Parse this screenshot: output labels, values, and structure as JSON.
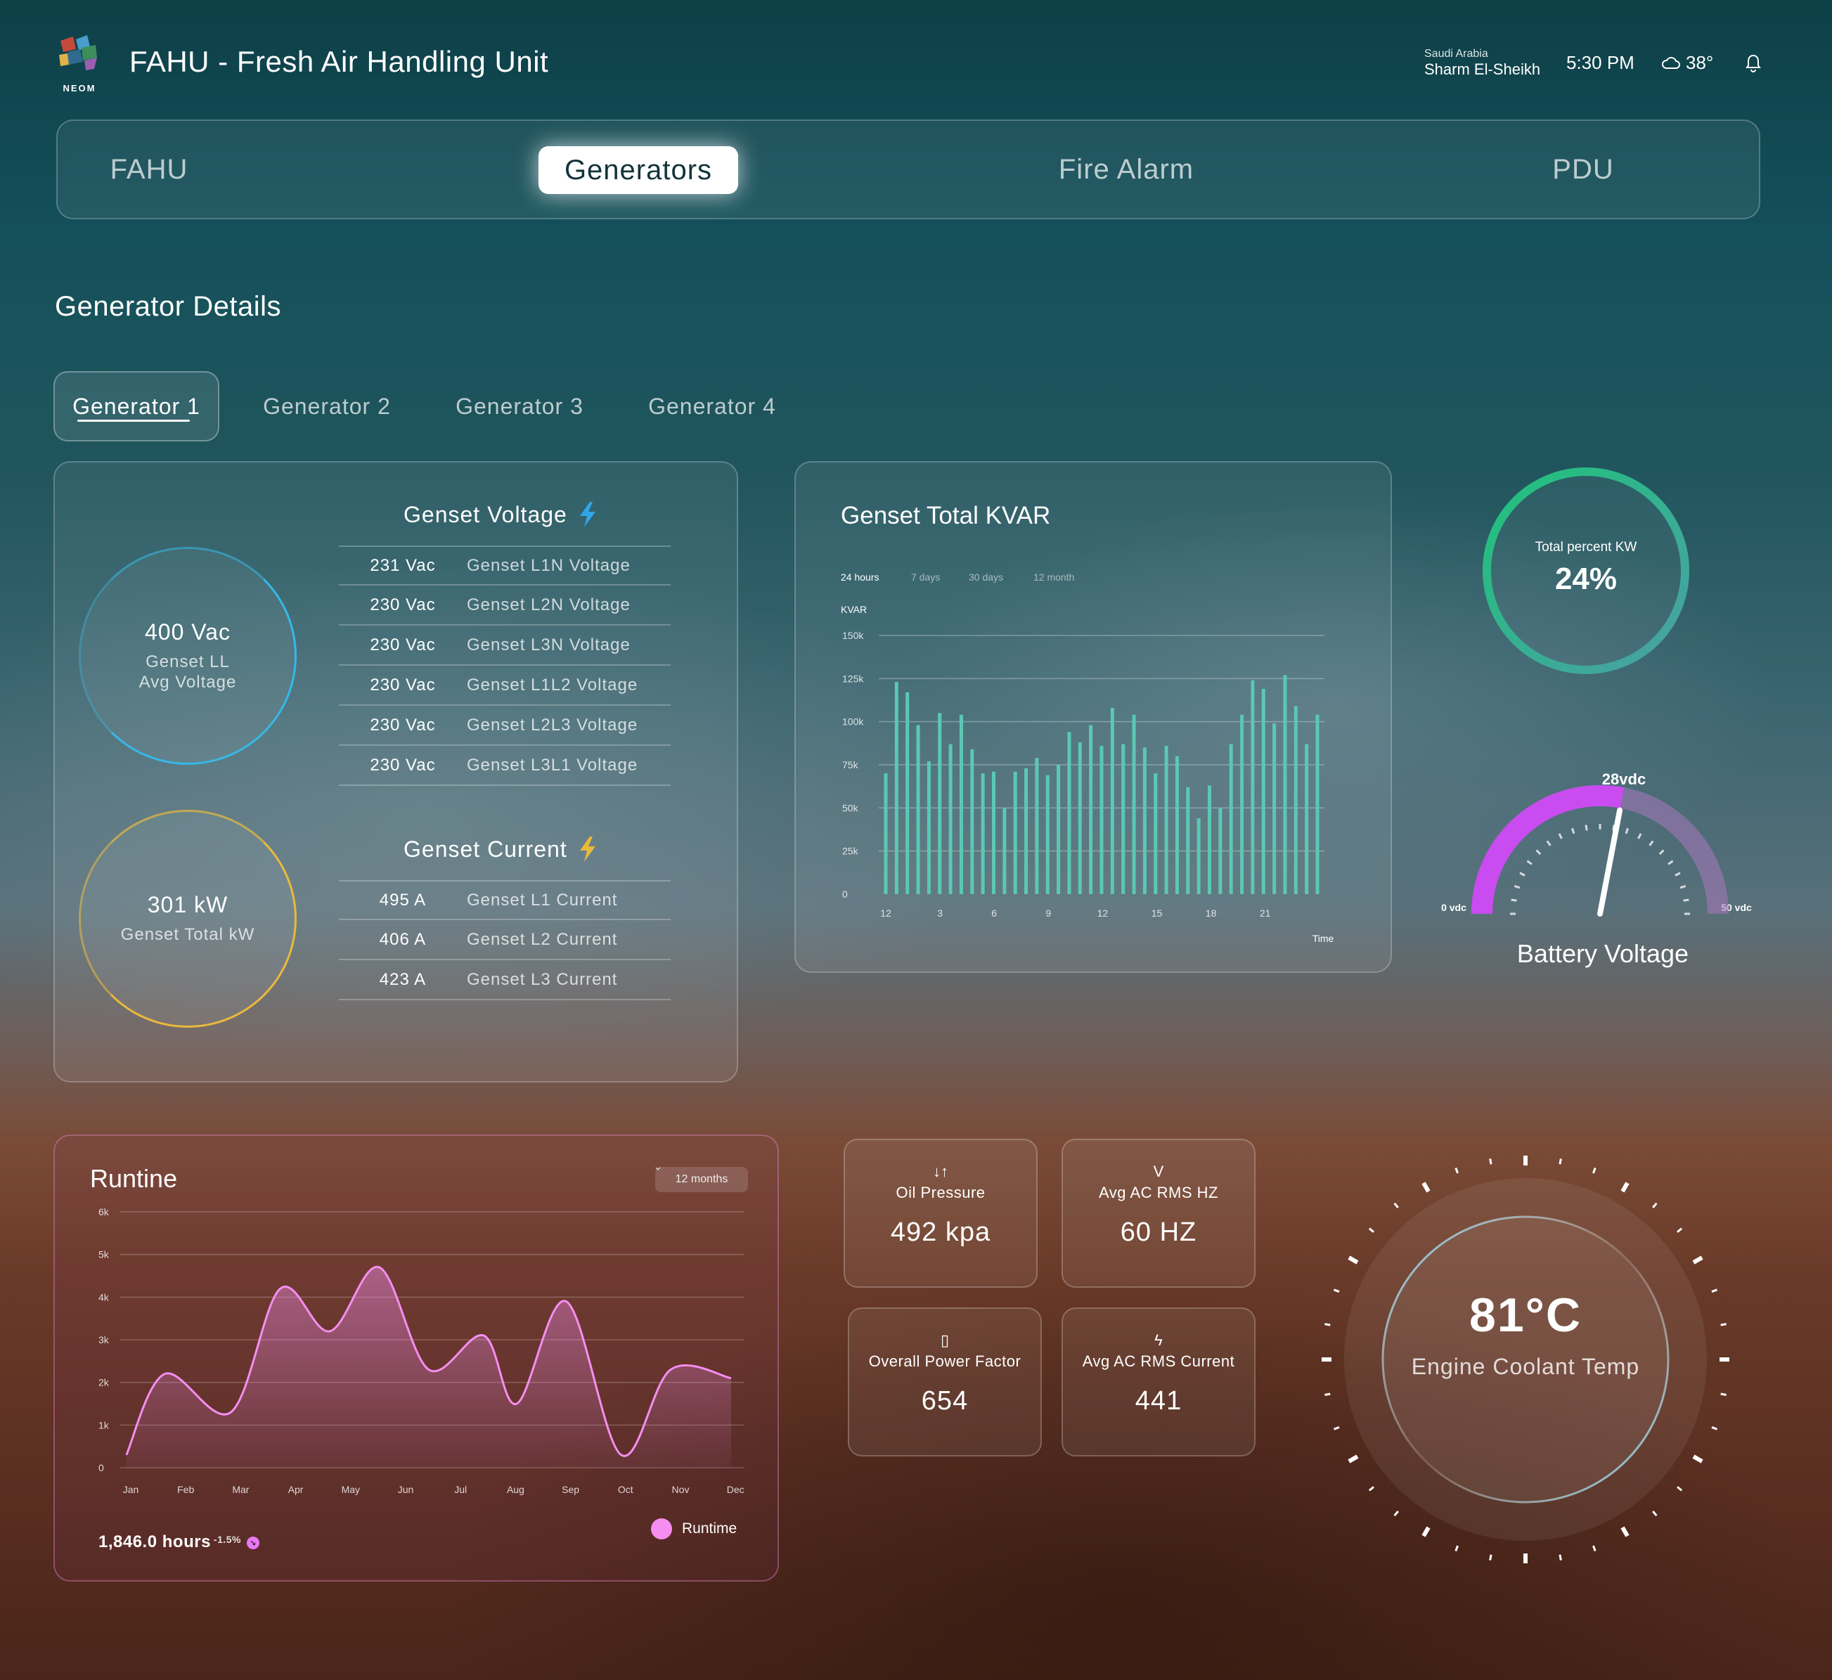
{
  "header": {
    "logo_text": "NEOM",
    "title": "FAHU - Fresh Air Handling Unit",
    "country": "Saudi Arabia",
    "city": "Sharm El-Sheikh",
    "time": "5:30 PM",
    "temperature": "38°"
  },
  "nav": {
    "tabs": [
      {
        "label": "FAHU"
      },
      {
        "label": "Generators"
      },
      {
        "label": "Fire Alarm"
      },
      {
        "label": "PDU"
      }
    ],
    "active": 1
  },
  "section_title": "Generator Details",
  "generators": {
    "tabs": [
      "Generator 1",
      "Generator 2",
      "Generator 3",
      "Generator 4"
    ],
    "active": 0
  },
  "voltage_card": {
    "avg_voltage_value": "400 Vac",
    "avg_voltage_label_1": "Genset LL",
    "avg_voltage_label_2": "Avg Voltage",
    "total_kw_value": "301 kW",
    "total_kw_label": "Genset Total kW",
    "voltage_title": "Genset Voltage",
    "voltage_rows": [
      {
        "value": "231 Vac",
        "label": "Genset L1N Voltage"
      },
      {
        "value": "230 Vac",
        "label": "Genset L2N Voltage"
      },
      {
        "value": "230 Vac",
        "label": "Genset L3N Voltage"
      },
      {
        "value": "230 Vac",
        "label": "Genset L1L2 Voltage"
      },
      {
        "value": "230 Vac",
        "label": "Genset L2L3 Voltage"
      },
      {
        "value": "230 Vac",
        "label": "Genset L3L1 Voltage"
      }
    ],
    "current_title": "Genset Current",
    "current_rows": [
      {
        "value": "495 A",
        "label": "Genset L1 Current"
      },
      {
        "value": "406 A",
        "label": "Genset L2 Current"
      },
      {
        "value": "423 A",
        "label": "Genset L3 Current"
      }
    ],
    "colors": {
      "voltage_ring": "#36b8e8",
      "kw_ring": "#e9b93c"
    }
  },
  "kvar": {
    "title": "Genset Total KVAR",
    "ranges": [
      "24 hours",
      "7 days",
      "30 days",
      "12 month"
    ],
    "active_range": 0,
    "color": "#5bc8b4"
  },
  "runtime": {
    "title": "Runtine",
    "period": "12 months",
    "total": "1,846.0 hours",
    "change": "-1.5%",
    "legend": "Runtime",
    "color": "#f58ef0"
  },
  "total_percent": {
    "label": "Total percent  KW",
    "value": "24%",
    "fraction": 0.24
  },
  "battery": {
    "title": "Battery Voltage",
    "value_label": "28vdc",
    "min_label": "0 vdc",
    "max_label": "50 vdc",
    "value": 28,
    "min": 0,
    "max": 50,
    "color": "#c84cf0"
  },
  "metrics": [
    {
      "icon": "oil-pressure-icon",
      "glyph": "↓↑",
      "label": "Oil Pressure",
      "value": "492 kpa"
    },
    {
      "icon": "frequency-icon",
      "glyph": "V",
      "label": "Avg AC RMS HZ",
      "value": "60 HZ"
    },
    {
      "icon": "battery-icon",
      "glyph": "▯",
      "label": "Overall Power Factor",
      "value": "654"
    },
    {
      "icon": "bolt-icon",
      "glyph": "ϟ",
      "label": "Avg AC RMS Current",
      "value": "441"
    }
  ],
  "coolant": {
    "value": "81°C",
    "label": "Engine Coolant Temp"
  },
  "chart_data": [
    {
      "type": "bar",
      "title": "Genset Total KVAR",
      "xlabel": "Time",
      "ylabel": "KVAR",
      "ylim": [
        0,
        150000
      ],
      "yticks": [
        "0",
        "25k",
        "50k",
        "75k",
        "100k",
        "125k",
        "150k"
      ],
      "xticks": [
        "12",
        "3",
        "6",
        "9",
        "12",
        "15",
        "18",
        "21"
      ],
      "grid": true,
      "values": [
        70000,
        123000,
        117000,
        98000,
        77000,
        105000,
        87000,
        104000,
        84000,
        70000,
        71000,
        50000,
        71000,
        73000,
        79000,
        69000,
        75000,
        94000,
        88000,
        98000,
        86000,
        108000,
        87000,
        104000,
        85000,
        70000,
        86000,
        80000,
        62000,
        44000,
        63000,
        50000,
        87000,
        104000,
        124000,
        119000,
        99000,
        127000,
        109000,
        87000,
        104000
      ]
    },
    {
      "type": "area",
      "title": "Runtine",
      "ylim": [
        0,
        6000
      ],
      "yticks": [
        "0",
        "1k",
        "2k",
        "3k",
        "4k",
        "5k",
        "6k"
      ],
      "categories": [
        "Jan",
        "Feb",
        "Mar",
        "Apr",
        "May",
        "Jun",
        "Jul",
        "Aug",
        "Sep",
        "Oct",
        "Nov",
        "Dec"
      ],
      "grid": true,
      "legend": "bottom-right",
      "series": [
        {
          "name": "Runtime",
          "x": [
            0,
            0.7,
            1.9,
            2.8,
            3.7,
            4.6,
            5.5,
            6.5,
            7.1,
            8.0,
            9.0,
            9.9,
            11.0
          ],
          "values": [
            300,
            2200,
            1300,
            4200,
            3200,
            4700,
            2300,
            3100,
            1500,
            3900,
            300,
            2300,
            2100
          ]
        }
      ]
    }
  ]
}
